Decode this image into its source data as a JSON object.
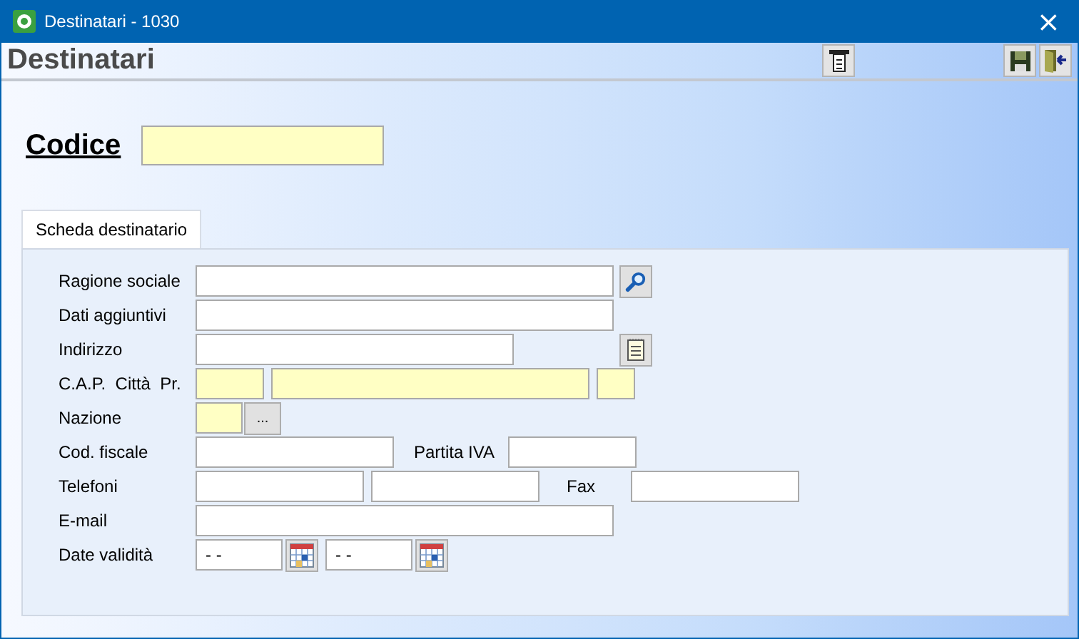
{
  "window": {
    "title": "Destinatari - 1030",
    "close": "×"
  },
  "header": {
    "title": "Destinatari"
  },
  "codice": {
    "label": "Codice",
    "required": true
  },
  "tabs": [
    {
      "label": "Scheda destinatario",
      "selected": true
    }
  ],
  "rows": [
    {
      "label": "Ragione sociale",
      "items": [
        {
          "kind": "field",
          "required": false
        },
        {
          "kind": "search"
        }
      ]
    },
    {
      "label": "Dati aggiuntivi",
      "items": [
        {
          "kind": "field",
          "required": false
        }
      ]
    },
    {
      "label": "Indirizzo",
      "items": [
        {
          "kind": "field",
          "required": false
        },
        {
          "kind": "notes"
        }
      ]
    },
    {
      "label": "C.A.P.  Città  Pr.",
      "items": [
        {
          "kind": "field",
          "required": true
        },
        {
          "kind": "field",
          "required": true
        },
        {
          "kind": "field",
          "required": true
        }
      ]
    },
    {
      "label": "Nazione",
      "items": [
        {
          "kind": "field",
          "required": true
        },
        {
          "kind": "more",
          "text": "..."
        }
      ]
    },
    {
      "label": "Cod. fiscale",
      "items": [
        {
          "kind": "field",
          "required": false
        },
        {
          "kind": "label",
          "text": "Partita IVA"
        },
        {
          "kind": "field",
          "required": false
        }
      ]
    },
    {
      "label": "Telefoni",
      "items": [
        {
          "kind": "field",
          "required": false
        },
        {
          "kind": "field",
          "required": false
        },
        {
          "kind": "label",
          "text": "Fax"
        },
        {
          "kind": "field",
          "required": false
        }
      ]
    },
    {
      "label": "E-mail",
      "items": [
        {
          "kind": "field",
          "required": false
        }
      ]
    },
    {
      "label": "Date validità",
      "items": [
        {
          "kind": "date",
          "value": "- -"
        },
        {
          "kind": "calendar"
        },
        {
          "kind": "date",
          "value": "- -"
        },
        {
          "kind": "calendar"
        }
      ]
    }
  ]
}
